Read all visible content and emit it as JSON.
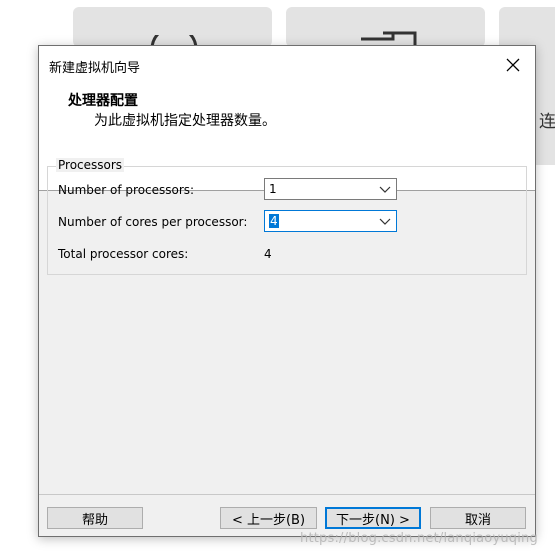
{
  "background": {
    "partial_text": "连"
  },
  "dialog": {
    "title": "新建虚拟机向导",
    "header_title": "处理器配置",
    "header_subtitle": "为此虚拟机指定处理器数量。",
    "group_label": "Processors",
    "processors_label": "Number of processors:",
    "processors_value": "1",
    "cores_label": "Number of cores per processor:",
    "cores_value": "4",
    "total_label": "Total processor cores:",
    "total_value": "4",
    "buttons": {
      "help": "帮助",
      "back": "< 上一步(B)",
      "next": "下一步(N) >",
      "cancel": "取消"
    }
  },
  "watermark": "https://blog.csdn.net/lanqiaoyuqing",
  "colors": {
    "accent": "#0078d7",
    "dialog_bg": "#f0f0f0",
    "tile_bg": "#e3e3e3"
  }
}
